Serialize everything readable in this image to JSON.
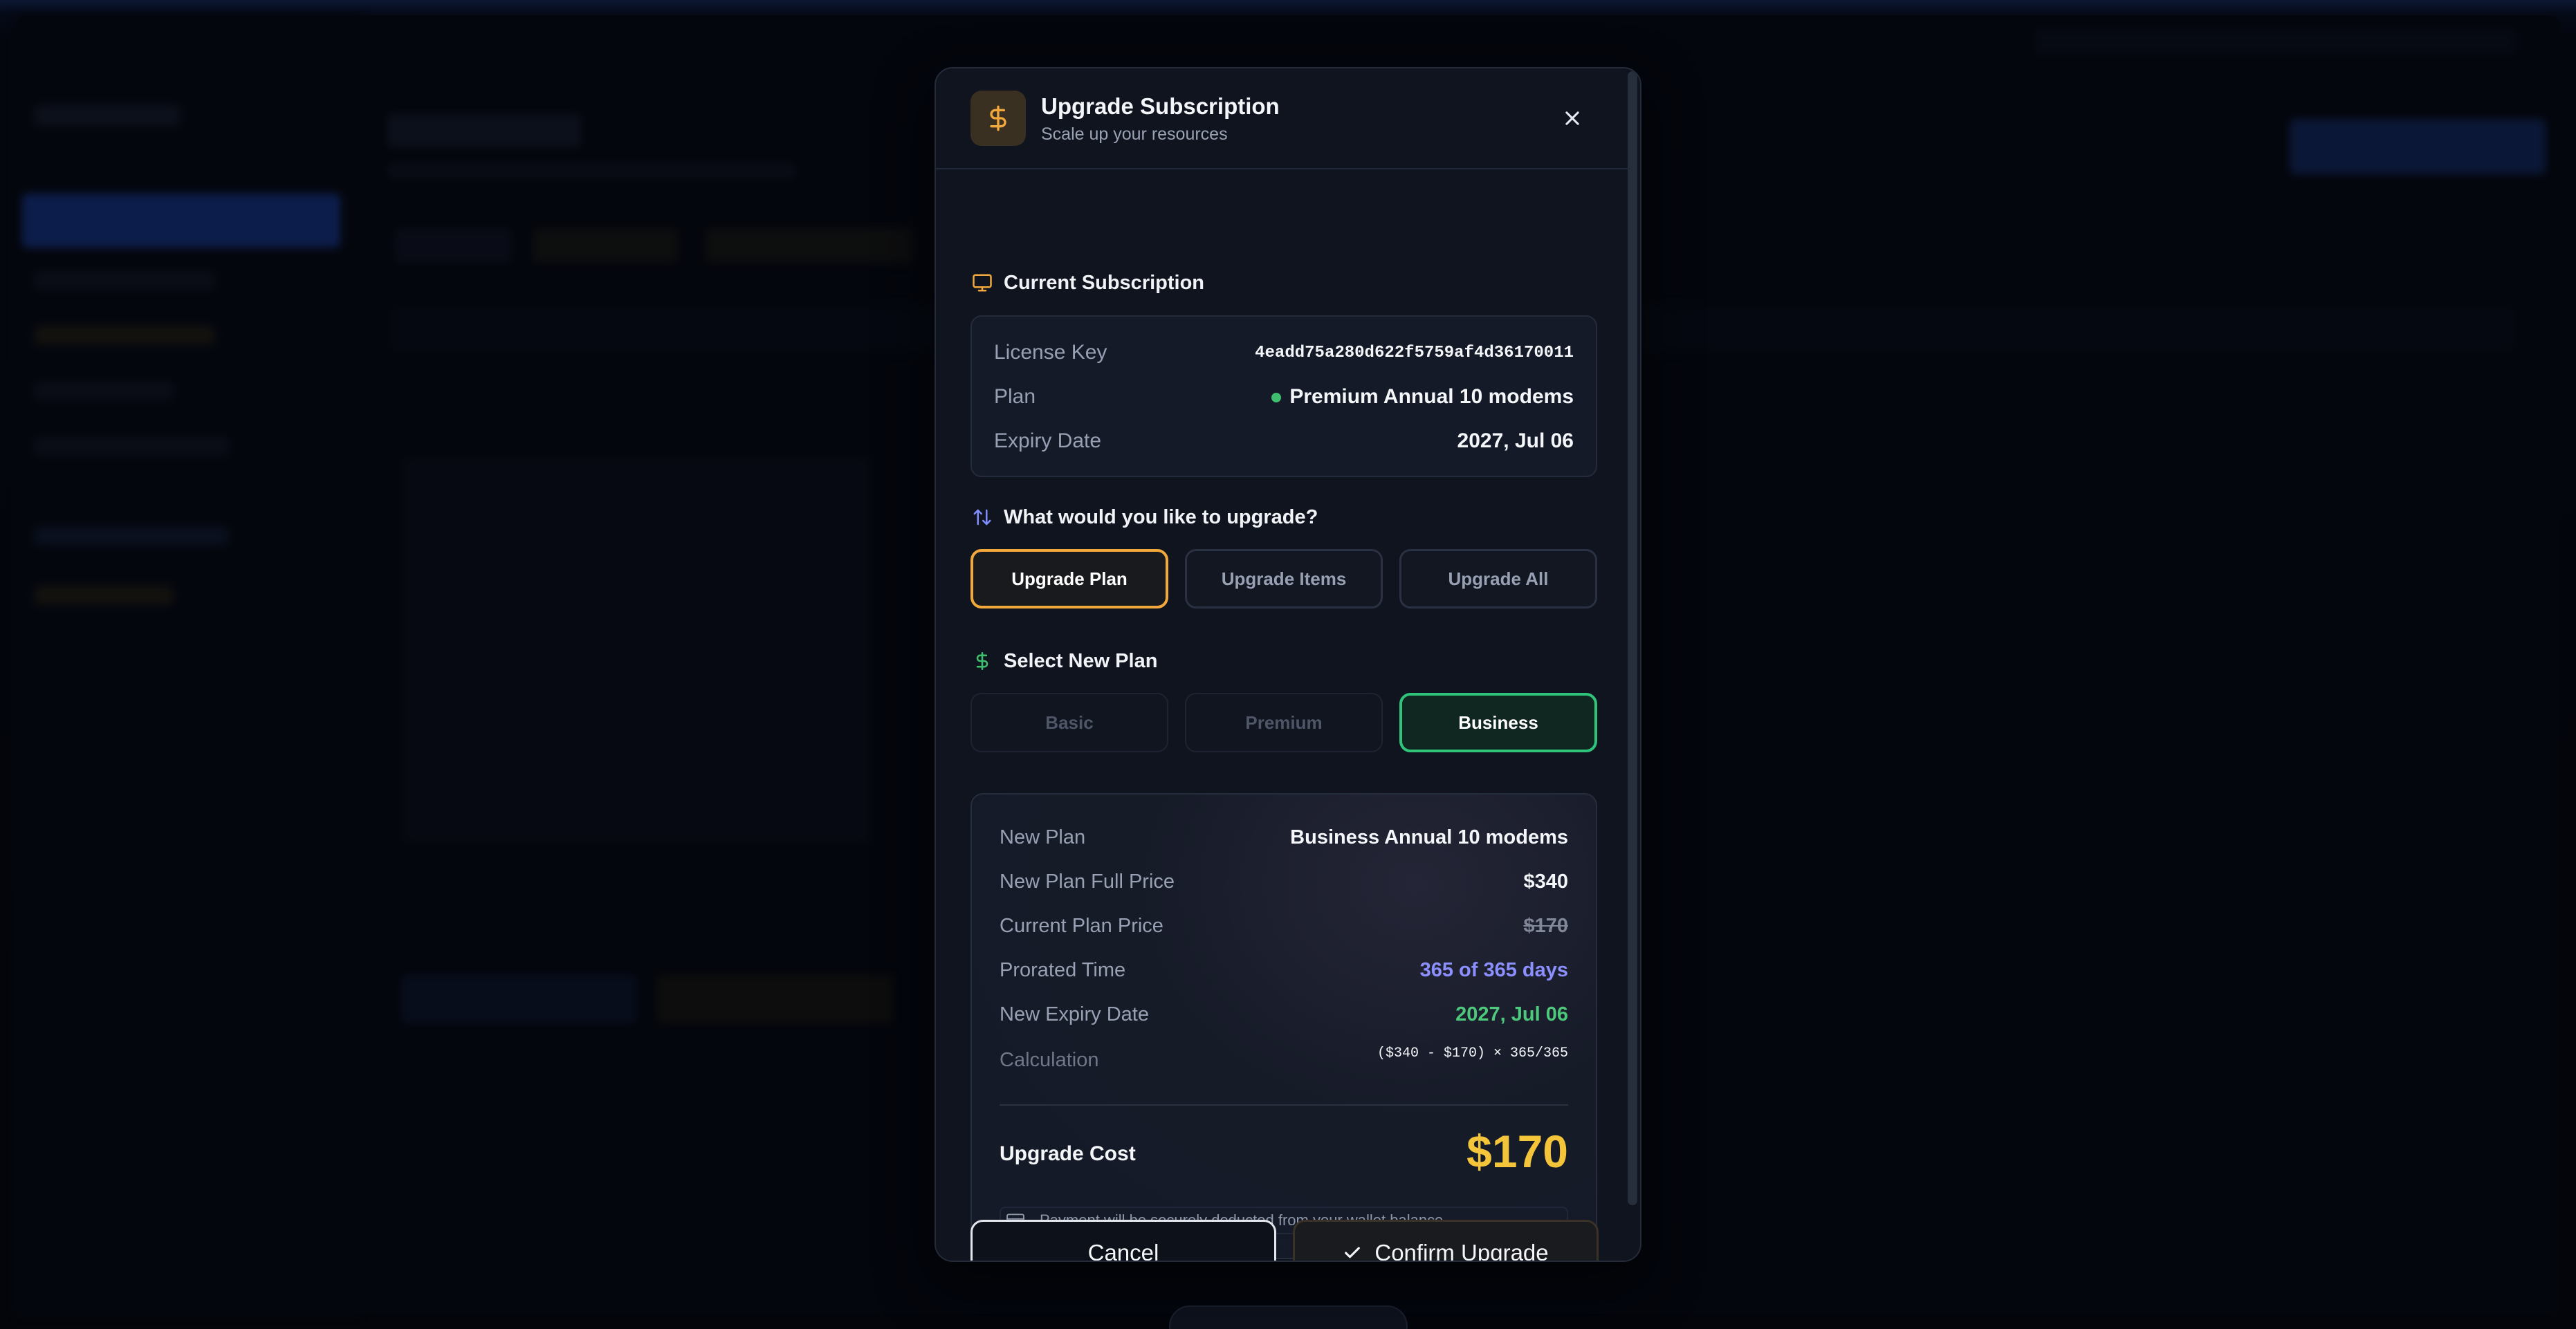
{
  "modal": {
    "title": "Upgrade Subscription",
    "subtitle": "Scale up your resources",
    "header_icon": "dollar-icon",
    "close_icon": "close-icon"
  },
  "current_subscription": {
    "title": "Current Subscription",
    "icon": "monitor-icon",
    "license_key_label": "License Key",
    "license_key_value": "4eadd75a280d622f5759af4d36170011",
    "plan_label": "Plan",
    "plan_value": "Premium Annual 10 modems",
    "expiry_label": "Expiry Date",
    "expiry_value": "2027, Jul 06"
  },
  "upgrade_type": {
    "title": "What would you like to upgrade?",
    "icon": "arrows-updown-icon",
    "options": [
      "Upgrade Plan",
      "Upgrade Items",
      "Upgrade All"
    ],
    "selected": "Upgrade Plan"
  },
  "new_plan": {
    "title": "Select New Plan",
    "icon": "dollar-icon",
    "options": [
      "Basic",
      "Premium",
      "Business"
    ],
    "selected": "Business"
  },
  "summary": {
    "new_plan_label": "New Plan",
    "new_plan_value": "Business Annual 10 modems",
    "full_price_label": "New Plan Full Price",
    "full_price_value": "$340",
    "current_price_label": "Current Plan Price",
    "current_price_value": "$170",
    "prorated_label": "Prorated Time",
    "prorated_value": "365 of 365 days",
    "new_expiry_label": "New Expiry Date",
    "new_expiry_value": "2027, Jul 06",
    "calculation_label": "Calculation",
    "calculation_value": "($340 - $170) × 365/365",
    "cost_label": "Upgrade Cost",
    "cost_value": "$170",
    "note": "Payment will be securely deducted from your wallet balance."
  },
  "footer": {
    "cancel_label": "Cancel",
    "confirm_label": "Confirm Upgrade"
  },
  "colors": {
    "accent_amber": "#f2a93b",
    "accent_green": "#2fc47a",
    "cost_yellow": "#f4c43a",
    "prorated_purple": "#8c90ff"
  }
}
